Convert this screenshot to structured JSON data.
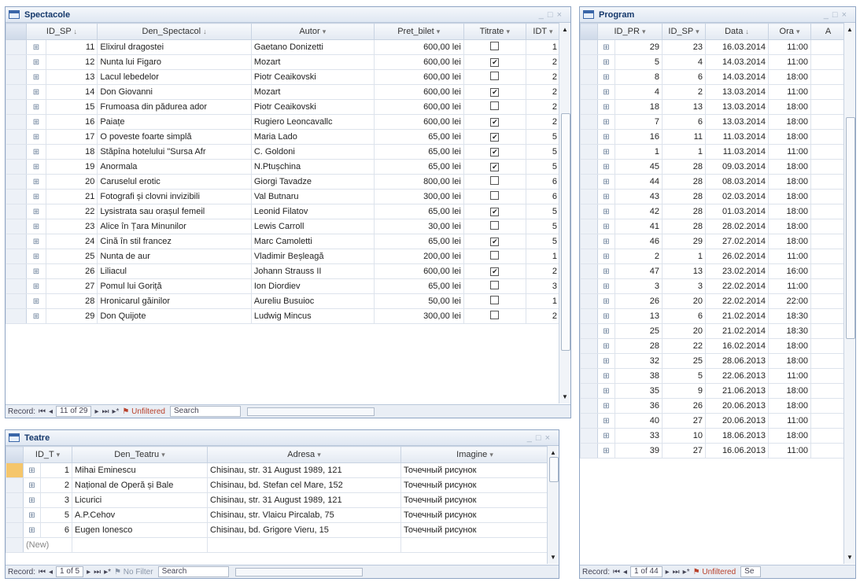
{
  "spectacole": {
    "title": "Spectacole",
    "columns": [
      {
        "label": "ID_SP",
        "arrow": "↓"
      },
      {
        "label": "Den_Spectacol",
        "arrow": "↓"
      },
      {
        "label": "Autor",
        "arrow": "▾"
      },
      {
        "label": "Pret_bilet",
        "arrow": "▾"
      },
      {
        "label": "Titrate",
        "arrow": "▾"
      },
      {
        "label": "IDT",
        "arrow": "▾"
      }
    ],
    "rows": [
      {
        "id": "11",
        "den": "Elixirul dragostei",
        "autor": "Gaetano Donizetti",
        "pret": "600,00 lei",
        "titrate": false,
        "idt": "1"
      },
      {
        "id": "12",
        "den": "Nunta lui Figaro",
        "autor": "Mozart",
        "pret": "600,00 lei",
        "titrate": true,
        "idt": "2"
      },
      {
        "id": "13",
        "den": "Lacul lebedelor",
        "autor": "Piotr Ceaikovski",
        "pret": "600,00 lei",
        "titrate": false,
        "idt": "2"
      },
      {
        "id": "14",
        "den": "Don Giovanni",
        "autor": "Mozart",
        "pret": "600,00 lei",
        "titrate": true,
        "idt": "2"
      },
      {
        "id": "15",
        "den": "Frumoasa din pădurea ador",
        "autor": "Piotr Ceaikovski",
        "pret": "600,00 lei",
        "titrate": false,
        "idt": "2"
      },
      {
        "id": "16",
        "den": "Paiațe",
        "autor": "Rugiero Leoncavallc",
        "pret": "600,00 lei",
        "titrate": true,
        "idt": "2"
      },
      {
        "id": "17",
        "den": "O poveste foarte simplă",
        "autor": "Maria Lado",
        "pret": "65,00 lei",
        "titrate": true,
        "idt": "5"
      },
      {
        "id": "18",
        "den": "Stăpîna hotelului \"Sursa Afr",
        "autor": "C. Goldoni",
        "pret": "65,00 lei",
        "titrate": true,
        "idt": "5"
      },
      {
        "id": "19",
        "den": "Anormala",
        "autor": "N.Ptușchina",
        "pret": "65,00 lei",
        "titrate": true,
        "idt": "5"
      },
      {
        "id": "20",
        "den": "Caruselul erotic",
        "autor": "Giorgi Tavadze",
        "pret": "800,00 lei",
        "titrate": false,
        "idt": "6"
      },
      {
        "id": "21",
        "den": "Fotografi și clovni invizibili",
        "autor": "Val Butnaru",
        "pret": "300,00 lei",
        "titrate": false,
        "idt": "6"
      },
      {
        "id": "22",
        "den": "Lysistrata sau orașul femeil",
        "autor": "Leonid Filatov",
        "pret": "65,00 lei",
        "titrate": true,
        "idt": "5"
      },
      {
        "id": "23",
        "den": "Alice în Țara Minunilor",
        "autor": "Lewis Carroll",
        "pret": "30,00 lei",
        "titrate": false,
        "idt": "5"
      },
      {
        "id": "24",
        "den": "Cină în stil francez",
        "autor": "Marc Camoletti",
        "pret": "65,00 lei",
        "titrate": true,
        "idt": "5"
      },
      {
        "id": "25",
        "den": "Nunta de aur",
        "autor": "Vladimir Beșleagă",
        "pret": "200,00 lei",
        "titrate": false,
        "idt": "1"
      },
      {
        "id": "26",
        "den": "Liliacul",
        "autor": "Johann Strauss II",
        "pret": "600,00 lei",
        "titrate": true,
        "idt": "2"
      },
      {
        "id": "27",
        "den": "Pomul lui Goriță",
        "autor": "Ion Diordiev",
        "pret": "65,00 lei",
        "titrate": false,
        "idt": "3"
      },
      {
        "id": "28",
        "den": "Hronicarul găinilor",
        "autor": "Aureliu Busuioc",
        "pret": "50,00 lei",
        "titrate": false,
        "idt": "1"
      },
      {
        "id": "29",
        "den": "Don Quijote",
        "autor": "Ludwig Mincus",
        "pret": "300,00 lei",
        "titrate": false,
        "idt": "2"
      }
    ],
    "record_label": "Record:",
    "record_pos": "11 of 29",
    "filter": "Unfiltered",
    "search": "Search"
  },
  "teatre": {
    "title": "Teatre",
    "columns": [
      {
        "label": "ID_T",
        "arrow": "▾"
      },
      {
        "label": "Den_Teatru",
        "arrow": "▾"
      },
      {
        "label": "Adresa",
        "arrow": "▾"
      },
      {
        "label": "Imagine",
        "arrow": "▾"
      }
    ],
    "rows": [
      {
        "id": "1",
        "den": "Mihai Eminescu",
        "adresa": "Chisinau, str. 31 August 1989, 121",
        "imagine": "Точечный рисунок"
      },
      {
        "id": "2",
        "den": "Național de Operă și Bale",
        "adresa": "Chisinau, bd. Stefan cel Mare, 152",
        "imagine": "Точечный рисунок"
      },
      {
        "id": "3",
        "den": "Licurici",
        "adresa": "Chisinau, str. 31 August 1989, 121",
        "imagine": "Точечный рисунок"
      },
      {
        "id": "5",
        "den": "A.P.Cehov",
        "adresa": "Chisinau, str. Vlaicu Pircalab, 75",
        "imagine": "Точечный рисунок"
      },
      {
        "id": "6",
        "den": "Eugen Ionesco",
        "adresa": "Chisinau, bd. Grigore Vieru, 15",
        "imagine": "Точечный рисунок"
      }
    ],
    "new_row": "(New)",
    "record_label": "Record:",
    "record_pos": "1 of 5",
    "filter": "No Filter",
    "search": "Search"
  },
  "program": {
    "title": "Program",
    "columns": [
      {
        "label": "ID_PR",
        "arrow": "▾"
      },
      {
        "label": "ID_SP",
        "arrow": "▾"
      },
      {
        "label": "Data",
        "arrow": "↓"
      },
      {
        "label": "Ora",
        "arrow": "▾"
      },
      {
        "label": "A",
        "arrow": ""
      }
    ],
    "rows": [
      {
        "id": "29",
        "sp": "23",
        "data": "16.03.2014",
        "ora": "11:00"
      },
      {
        "id": "5",
        "sp": "4",
        "data": "14.03.2014",
        "ora": "11:00"
      },
      {
        "id": "8",
        "sp": "6",
        "data": "14.03.2014",
        "ora": "18:00"
      },
      {
        "id": "4",
        "sp": "2",
        "data": "13.03.2014",
        "ora": "11:00"
      },
      {
        "id": "18",
        "sp": "13",
        "data": "13.03.2014",
        "ora": "18:00"
      },
      {
        "id": "7",
        "sp": "6",
        "data": "13.03.2014",
        "ora": "18:00"
      },
      {
        "id": "16",
        "sp": "11",
        "data": "11.03.2014",
        "ora": "18:00"
      },
      {
        "id": "1",
        "sp": "1",
        "data": "11.03.2014",
        "ora": "11:00"
      },
      {
        "id": "45",
        "sp": "28",
        "data": "09.03.2014",
        "ora": "18:00"
      },
      {
        "id": "44",
        "sp": "28",
        "data": "08.03.2014",
        "ora": "18:00"
      },
      {
        "id": "43",
        "sp": "28",
        "data": "02.03.2014",
        "ora": "18:00"
      },
      {
        "id": "42",
        "sp": "28",
        "data": "01.03.2014",
        "ora": "18:00"
      },
      {
        "id": "41",
        "sp": "28",
        "data": "28.02.2014",
        "ora": "18:00"
      },
      {
        "id": "46",
        "sp": "29",
        "data": "27.02.2014",
        "ora": "18:00"
      },
      {
        "id": "2",
        "sp": "1",
        "data": "26.02.2014",
        "ora": "11:00"
      },
      {
        "id": "47",
        "sp": "13",
        "data": "23.02.2014",
        "ora": "16:00"
      },
      {
        "id": "3",
        "sp": "3",
        "data": "22.02.2014",
        "ora": "11:00"
      },
      {
        "id": "26",
        "sp": "20",
        "data": "22.02.2014",
        "ora": "22:00"
      },
      {
        "id": "13",
        "sp": "6",
        "data": "21.02.2014",
        "ora": "18:30"
      },
      {
        "id": "25",
        "sp": "20",
        "data": "21.02.2014",
        "ora": "18:30"
      },
      {
        "id": "28",
        "sp": "22",
        "data": "16.02.2014",
        "ora": "18:00"
      },
      {
        "id": "32",
        "sp": "25",
        "data": "28.06.2013",
        "ora": "18:00"
      },
      {
        "id": "38",
        "sp": "5",
        "data": "22.06.2013",
        "ora": "11:00"
      },
      {
        "id": "35",
        "sp": "9",
        "data": "21.06.2013",
        "ora": "18:00"
      },
      {
        "id": "36",
        "sp": "26",
        "data": "20.06.2013",
        "ora": "18:00"
      },
      {
        "id": "40",
        "sp": "27",
        "data": "20.06.2013",
        "ora": "11:00"
      },
      {
        "id": "33",
        "sp": "10",
        "data": "18.06.2013",
        "ora": "18:00"
      },
      {
        "id": "39",
        "sp": "27",
        "data": "16.06.2013",
        "ora": "11:00"
      }
    ],
    "record_label": "Record:",
    "record_pos": "1 of 44",
    "filter": "Unfiltered",
    "search": "Se"
  },
  "icons": {
    "expand": "⊞",
    "check": "✔",
    "nav_first": "⏮",
    "nav_prev": "◂",
    "nav_next": "▸",
    "nav_last": "⏭",
    "nav_new": "▸*",
    "close": "×",
    "minimize": "_",
    "maximize": "□"
  },
  "colors": {
    "current_row": "#f5c66b",
    "title_text": "#15386b",
    "filter_icon": "#b8402a"
  }
}
